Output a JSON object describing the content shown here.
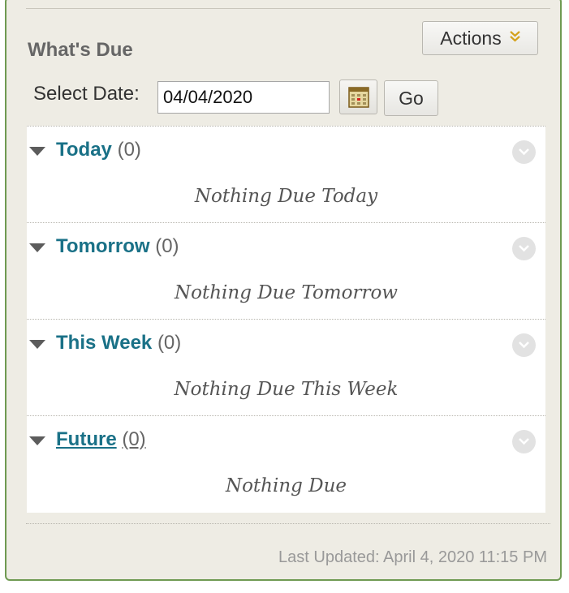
{
  "module": {
    "title": "What's Due",
    "actions_label": "Actions"
  },
  "date_picker": {
    "label": "Select Date:",
    "value": "04/04/2020",
    "go_label": "Go"
  },
  "sections": [
    {
      "title": "Today",
      "count": "(0)",
      "empty_message": "Nothing Due Today"
    },
    {
      "title": "Tomorrow",
      "count": "(0)",
      "empty_message": "Nothing Due Tomorrow"
    },
    {
      "title": "This Week",
      "count": "(0)",
      "empty_message": "Nothing Due This Week"
    },
    {
      "title": "Future",
      "count": "(0)",
      "empty_message": "Nothing Due"
    }
  ],
  "footer": {
    "last_updated": "Last Updated: April 4, 2020 11:15 PM"
  },
  "colors": {
    "panel_bg": "#eeece4",
    "panel_border": "#6f9a52",
    "link": "#1a7187",
    "accent_chevron": "#d4a21c"
  },
  "icons": [
    "double-chevron-down-icon",
    "calendar-icon",
    "collapse-triangle-icon",
    "circle-chevron-down-icon"
  ]
}
